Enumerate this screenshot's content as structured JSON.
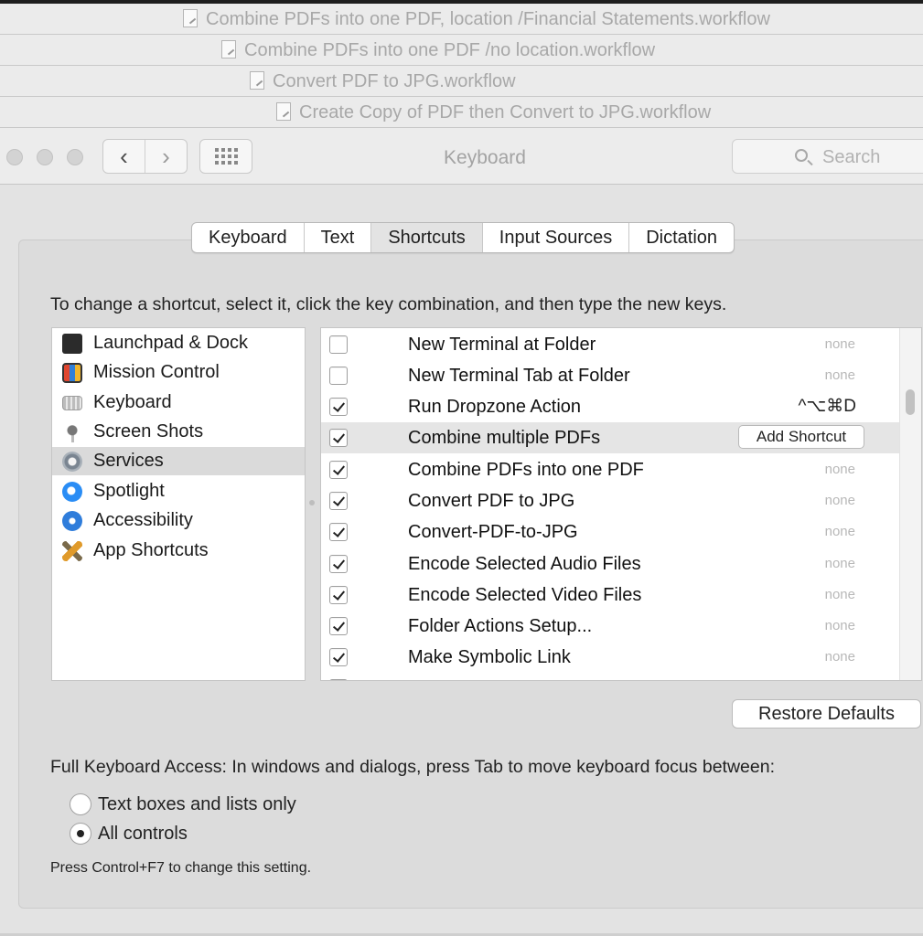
{
  "background_windows": [
    {
      "title": "Combine PDFs into one PDF, location /Financial Statements.workflow"
    },
    {
      "title": "Combine PDFs into one PDF /no location.workflow"
    },
    {
      "title": "Convert PDF to JPG.workflow"
    },
    {
      "title": "Create Copy of PDF then Convert to JPG.workflow"
    }
  ],
  "window": {
    "title": "Keyboard",
    "back_label": "‹",
    "forward_label": "›",
    "search_placeholder": "Search"
  },
  "tabs": [
    {
      "label": "Keyboard"
    },
    {
      "label": "Text"
    },
    {
      "label": "Shortcuts",
      "active": true
    },
    {
      "label": "Input Sources"
    },
    {
      "label": "Dictation"
    }
  ],
  "instructions": "To change a shortcut, select it, click the key combination, and then type the new keys.",
  "categories": [
    {
      "label": "Launchpad & Dock",
      "icon": "launchpad-icon"
    },
    {
      "label": "Mission Control",
      "icon": "mission-control-icon"
    },
    {
      "label": "Keyboard",
      "icon": "keyboard-icon"
    },
    {
      "label": "Screen Shots",
      "icon": "screenshot-icon"
    },
    {
      "label": "Services",
      "icon": "services-gear-icon",
      "selected": true
    },
    {
      "label": "Spotlight",
      "icon": "spotlight-icon"
    },
    {
      "label": "Accessibility",
      "icon": "accessibility-icon"
    },
    {
      "label": "App Shortcuts",
      "icon": "app-shortcuts-icon"
    }
  ],
  "services": [
    {
      "name": "New Terminal at Folder",
      "checked": false,
      "shortcut": "none"
    },
    {
      "name": "New Terminal Tab at Folder",
      "checked": false,
      "shortcut": "none"
    },
    {
      "name": "Run Dropzone Action",
      "checked": true,
      "shortcut": "^⌥⌘D"
    },
    {
      "name": "Combine multiple PDFs",
      "checked": true,
      "shortcut": "",
      "button": "Add Shortcut",
      "selected": true
    },
    {
      "name": "Combine PDFs into one PDF",
      "checked": true,
      "shortcut": "none"
    },
    {
      "name": "Convert PDF to JPG",
      "checked": true,
      "shortcut": "none"
    },
    {
      "name": "Convert-PDF-to-JPG",
      "checked": true,
      "shortcut": "none"
    },
    {
      "name": "Encode Selected Audio Files",
      "checked": true,
      "shortcut": "none"
    },
    {
      "name": "Encode Selected Video Files",
      "checked": true,
      "shortcut": "none"
    },
    {
      "name": "Folder Actions Setup...",
      "checked": true,
      "shortcut": "none"
    },
    {
      "name": "Make Symbolic Link",
      "checked": true,
      "shortcut": "none"
    }
  ],
  "restore_defaults_label": "Restore Defaults",
  "full_keyboard_access": {
    "label": "Full Keyboard Access: In windows and dialogs, press Tab to move keyboard focus between:",
    "options": [
      {
        "label": "Text boxes and lists only",
        "selected": false
      },
      {
        "label": "All controls",
        "selected": true
      }
    ],
    "note": "Press Control+F7 to change this setting."
  }
}
